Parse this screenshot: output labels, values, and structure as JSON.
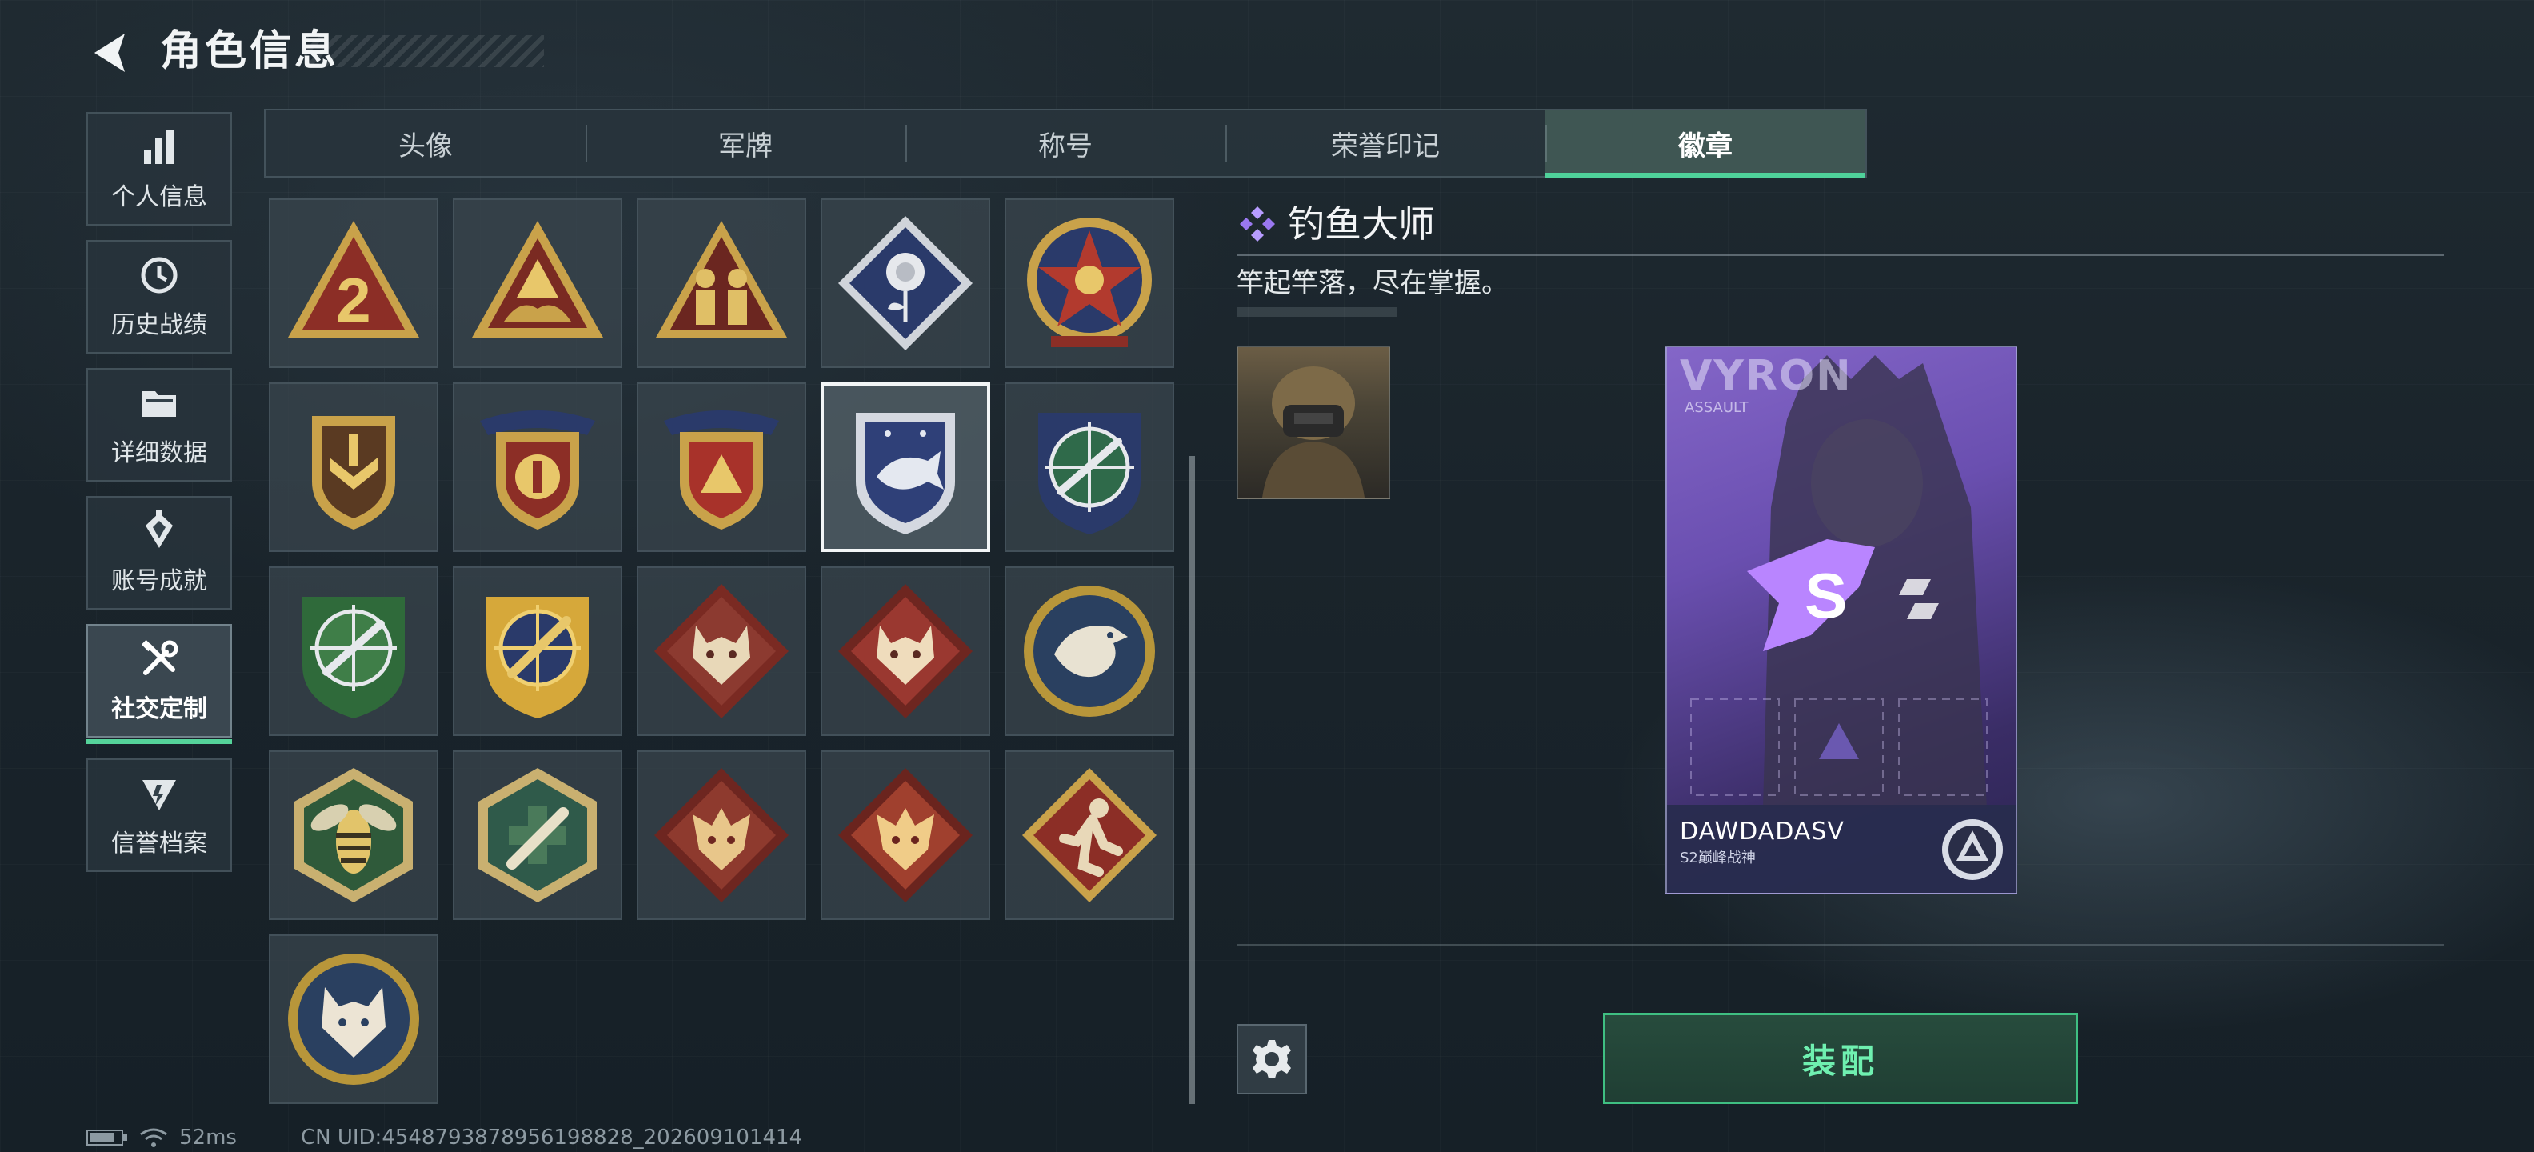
{
  "header": {
    "title": "角色信息"
  },
  "sidebar": {
    "items": [
      {
        "label": "个人信息",
        "icon": "bar-chart-icon",
        "active": false
      },
      {
        "label": "历史战绩",
        "icon": "history-clock-icon",
        "active": false
      },
      {
        "label": "详细数据",
        "icon": "folder-icon",
        "active": false
      },
      {
        "label": "账号成就",
        "icon": "achievement-icon",
        "active": false
      },
      {
        "label": "社交定制",
        "icon": "tools-icon",
        "active": true
      },
      {
        "label": "信誉档案",
        "icon": "reputation-icon",
        "active": false
      }
    ]
  },
  "tabs": [
    {
      "label": "头像",
      "active": false
    },
    {
      "label": "军牌",
      "active": false
    },
    {
      "label": "称号",
      "active": false
    },
    {
      "label": "荣誉印记",
      "active": false
    },
    {
      "label": "徽章",
      "active": true
    }
  ],
  "badges": [
    {
      "icon": "number-2-triangle-badge-icon"
    },
    {
      "icon": "hands-triangle-badge-icon"
    },
    {
      "icon": "soldiers-triangle-badge-icon"
    },
    {
      "icon": "rose-diamond-badge-icon"
    },
    {
      "icon": "star-circle-badge-icon"
    },
    {
      "icon": "chevron-shield-badge-icon"
    },
    {
      "icon": "winged-shield-badge-icon"
    },
    {
      "icon": "winged-shield-red-badge-icon"
    },
    {
      "icon": "fish-shield-badge-icon",
      "selected": true
    },
    {
      "icon": "crosshair-rifle-shield-badge-icon"
    },
    {
      "icon": "crosshair-rifle-green-badge-icon"
    },
    {
      "icon": "crosshair-knife-gold-badge-icon"
    },
    {
      "icon": "wolf-diamond-badge-icon"
    },
    {
      "icon": "wolf-diamond-red-badge-icon"
    },
    {
      "icon": "eagle-circle-badge-icon"
    },
    {
      "icon": "hornet-hexagon-badge-icon"
    },
    {
      "icon": "medic-hexagon-badge-icon"
    },
    {
      "icon": "dragon-diamond-badge-icon"
    },
    {
      "icon": "dragon-diamond-red-badge-icon"
    },
    {
      "icon": "runner-diamond-badge-icon"
    },
    {
      "icon": "lynx-circle-badge-icon"
    }
  ],
  "detail": {
    "name": "钓鱼大师",
    "description": "竿起竿落，尽在掌握。",
    "card": {
      "title": "VYRON",
      "subtitle": "ASSAULT",
      "player_name": "DAWDADASV",
      "rank": "S2巅峰战神"
    },
    "equip_label": "装配"
  },
  "status_bar": {
    "latency": "52ms",
    "uid": "CN UID:4548793878956198828_202609101414"
  },
  "colors": {
    "accent_green": "#4fd19a",
    "badge_gold": "#c9a24a",
    "badge_red": "#8c2e26",
    "badge_navy": "#2a3a6a",
    "card_purple": "#7a5cc0"
  }
}
